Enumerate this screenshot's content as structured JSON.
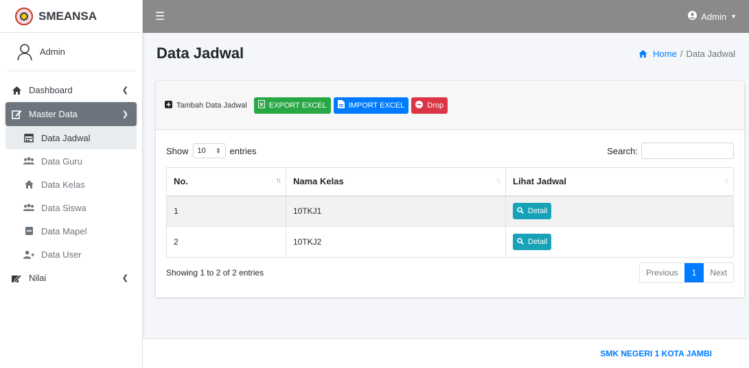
{
  "brand": {
    "name": "SMEANSA"
  },
  "user": {
    "name": "Admin"
  },
  "sidebar": {
    "items": [
      {
        "label": "Dashboard",
        "icon": "home-icon"
      },
      {
        "label": "Master Data",
        "icon": "edit-icon"
      },
      {
        "label": "Nilai",
        "icon": "signature-icon"
      }
    ],
    "submenu": [
      {
        "label": "Data Jadwal",
        "icon": "calendar-icon"
      },
      {
        "label": "Data Guru",
        "icon": "users-icon"
      },
      {
        "label": "Data Kelas",
        "icon": "home-icon"
      },
      {
        "label": "Data Siswa",
        "icon": "users-icon"
      },
      {
        "label": "Data Mapel",
        "icon": "book-icon"
      },
      {
        "label": "Data User",
        "icon": "user-plus-icon"
      }
    ]
  },
  "topbar": {
    "user_label": "Admin"
  },
  "page": {
    "title": "Data Jadwal"
  },
  "breadcrumb": {
    "home": "Home",
    "sep": "/",
    "current": "Data Jadwal"
  },
  "toolbar": {
    "add_label": "Tambah Data Jadwal",
    "export_label": "EXPORT EXCEL",
    "import_label": "IMPORT EXCEL",
    "drop_label": "Drop"
  },
  "datatable": {
    "show_label": "Show",
    "length_value": "10",
    "entries_label": "entries",
    "search_label": "Search:",
    "search_value": "",
    "columns": [
      "No.",
      "Nama Kelas",
      "Lihat Jadwal"
    ],
    "rows": [
      {
        "no": "1",
        "kelas": "10TKJ1",
        "action": "Detail"
      },
      {
        "no": "2",
        "kelas": "10TKJ2",
        "action": "Detail"
      }
    ],
    "info": "Showing 1 to 2 of 2 entries",
    "pagination": {
      "previous": "Previous",
      "current": "1",
      "next": "Next"
    }
  },
  "footer": {
    "text": "SMK NEGERI 1 KOTA JAMBI"
  },
  "colors": {
    "topbar": "#8a8a8a",
    "active_nav": "#6c757d",
    "primary": "#007bff",
    "success": "#28a745",
    "danger": "#dc3545",
    "info": "#17a2b8"
  }
}
